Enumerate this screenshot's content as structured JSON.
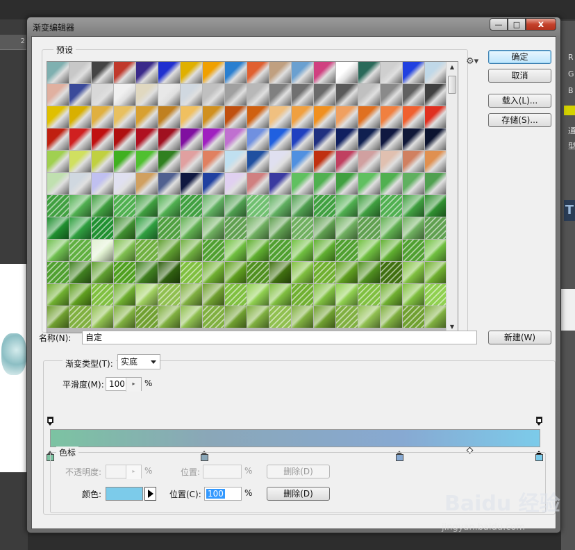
{
  "dialog": {
    "title": "渐变编辑器",
    "window_buttons": {
      "minimize": "—",
      "maximize": "□",
      "close": "x"
    }
  },
  "presets": {
    "legend": "预设",
    "gear_icon": "gear-icon",
    "colors": [
      [
        "#7fb0b0",
        "#c8c8c8",
        "#444444",
        "#c0392b",
        "#3a2a8a",
        "#2030d0",
        "#e0b000",
        "#f0a000",
        "#2a7fd0",
        "#e06030",
        "#c0a080",
        "#6aa0d0",
        "#d04080",
        "#ffffff",
        "#2a6a5a",
        "#cfcfcf",
        "#2040e0",
        "#c0d8e8"
      ],
      [
        "#e0b0a0",
        "#3a4a9a",
        "#d8d8d8",
        "#f0f0f0",
        "#e0d8c0",
        "#e8e8e8",
        "#d0d8e0",
        "#c0c0c0",
        "#a0a0a0",
        "#b8b8b8",
        "#808080",
        "#707070",
        "#6a6a6a",
        "#5a5a5a",
        "#c0c0c0",
        "#8a8a8a",
        "#606060",
        "#404040"
      ],
      [
        "#e0c000",
        "#d8b000",
        "#e0b040",
        "#e8c060",
        "#d8a030",
        "#c08020",
        "#f0c060",
        "#d09020",
        "#c05010",
        "#d06010",
        "#f0c080",
        "#f0a040",
        "#f09020",
        "#f0a060",
        "#e07020",
        "#f08040",
        "#f06030",
        "#e03020"
      ],
      [
        "#c02010",
        "#d02020",
        "#c01010",
        "#b01010",
        "#b01020",
        "#a01020",
        "#8010a0",
        "#a020c0",
        "#c070d0",
        "#7090e0",
        "#2060e0",
        "#2040c0",
        "#203080",
        "#102060",
        "#102050",
        "#101840",
        "#101838",
        "#0c1430"
      ],
      [
        "#a0d050",
        "#d0e060",
        "#c0d040",
        "#40b020",
        "#50c030",
        "#308020",
        "#e0a0a0",
        "#e08060",
        "#c0e0f0",
        "#2050a0",
        "#e0e0f0",
        "#5090e0",
        "#c03010",
        "#c04060",
        "#d0a0a0",
        "#e0c0b0",
        "#d08060",
        "#e09050"
      ],
      [
        "#c0e0b0",
        "#d0d8e0",
        "#c0c0f0",
        "#e0e0f0",
        "#d0a060",
        "#506090",
        "#101840",
        "#2040a0",
        "#e0d0f0",
        "#d08080",
        "#3a3aa0",
        "#60c060",
        "#50b050",
        "#40a040",
        "#60c060",
        "#50b050",
        "#60b060",
        "#50a050"
      ],
      [
        "#40a040",
        "#50b050",
        "#40a040",
        "#50b050",
        "#40a040",
        "#50b050",
        "#40a040",
        "#60b060",
        "#50a050",
        "#70c070",
        "#60b060",
        "#50a050",
        "#40a040",
        "#50b050",
        "#40a040",
        "#50b050",
        "#40a040",
        "#309030"
      ],
      [
        "#209030",
        "#30a040",
        "#209030",
        "#409030",
        "#30a040",
        "#50a040",
        "#60b050",
        "#70b060",
        "#60a050",
        "#70b060",
        "#60a050",
        "#70b060",
        "#60a050",
        "#70b060",
        "#60a050",
        "#60b050",
        "#70b060",
        "#60a050"
      ],
      [
        "#70c050",
        "#60b040",
        "#e0f0d0",
        "#80c050",
        "#70b040",
        "#60a030",
        "#70b040",
        "#50a030",
        "#70c040",
        "#60b030",
        "#50a030",
        "#70c040",
        "#60b030",
        "#50a030",
        "#70c040",
        "#60b030",
        "#50a030",
        "#70c040"
      ],
      [
        "#50a030",
        "#408020",
        "#60a030",
        "#50a020",
        "#408020",
        "#306010",
        "#80c040",
        "#70b030",
        "#60a020",
        "#509020",
        "#407010",
        "#80c040",
        "#70b030",
        "#60a020",
        "#509020",
        "#407010",
        "#80c040",
        "#70b030"
      ],
      [
        "#70b030",
        "#60a020",
        "#80c040",
        "#70b030",
        "#a0d060",
        "#90c050",
        "#80b040",
        "#70a030",
        "#80c040",
        "#90d050",
        "#80c040",
        "#70b030",
        "#80c040",
        "#90d050",
        "#80c040",
        "#70b030",
        "#80c040",
        "#90d050"
      ],
      [
        "#70a030",
        "#80b040",
        "#90c050",
        "#80b040",
        "#70a030",
        "#80b040",
        "#90c050",
        "#80b040",
        "#70a030",
        "#80b040",
        "#90c050",
        "#80b040",
        "#70a030",
        "#80b040",
        "#90c050",
        "#80b040",
        "#70a030",
        "#80b040"
      ]
    ]
  },
  "buttons": {
    "ok": "确定",
    "cancel": "取消",
    "load": "载入(L)...",
    "save": "存储(S)...",
    "new": "新建(W)"
  },
  "name": {
    "label": "名称(N):",
    "value": "自定"
  },
  "gradient": {
    "type_label": "渐变类型(T):",
    "type_value": "实底",
    "smoothness_label": "平滑度(M):",
    "smoothness_value": "100",
    "smoothness_unit": "%"
  },
  "color_stops": {
    "legend": "色标",
    "opacity_label": "不透明度:",
    "opacity_unit": "%",
    "opacity_position_label": "位置:",
    "opacity_position_unit": "%",
    "opacity_delete": "删除(D)",
    "color_label": "颜色:",
    "color_value": "#7ccbea",
    "color_position_label": "位置(C):",
    "color_position_value": "100",
    "color_position_unit": "%",
    "color_delete": "删除(D)"
  },
  "background": {
    "ruler_label": "2",
    "side_letters": [
      "R",
      "G",
      "B",
      "通",
      "型"
    ],
    "t_label": "T"
  },
  "watermark": {
    "text": "Baidu 经验",
    "url": "jingyan.baidu.com"
  }
}
